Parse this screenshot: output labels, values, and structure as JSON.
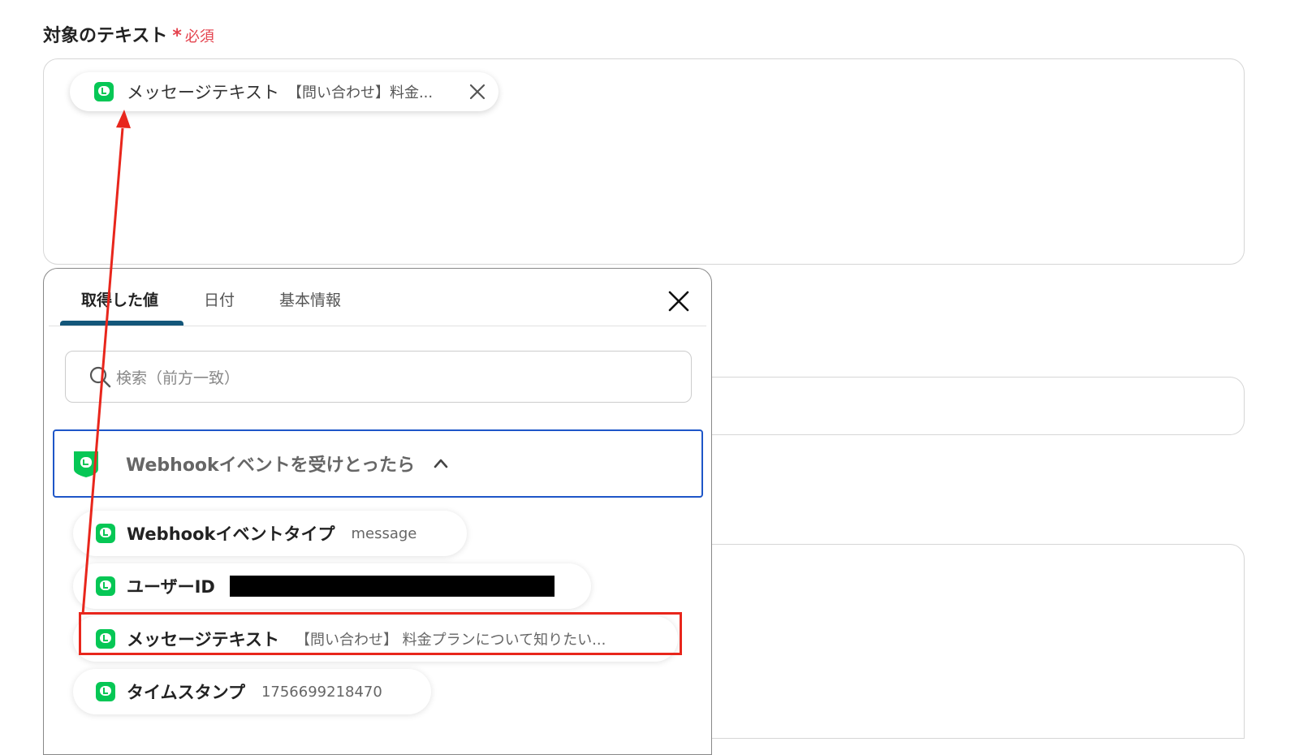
{
  "field": {
    "label": "対象のテキスト",
    "required_mark": "*",
    "required_text": "必須"
  },
  "token_chip": {
    "name": "メッセージテキスト",
    "preview": "【問い合わせ】料金..."
  },
  "popup": {
    "tabs": [
      {
        "label": "取得した値",
        "active": true
      },
      {
        "label": "日付",
        "active": false
      },
      {
        "label": "基本情報",
        "active": false
      }
    ],
    "search": {
      "placeholder": "検索（前方一致）"
    },
    "group": {
      "title": "Webhookイベントを受けとったら"
    },
    "items": [
      {
        "name": "Webhookイベントタイプ",
        "value": "message"
      },
      {
        "name": "ユーザーID",
        "value": ""
      },
      {
        "name": "メッセージテキスト",
        "value": "【問い合わせ】 料金プランについて知りたい..."
      },
      {
        "name": "タイムスタンプ",
        "value": "1756699218470"
      }
    ]
  },
  "colors": {
    "line_green": "#06c755",
    "required_red": "#e4424d",
    "annotation_red": "#e8261c",
    "active_tab": "#13577a",
    "group_border": "#1e56c8"
  }
}
